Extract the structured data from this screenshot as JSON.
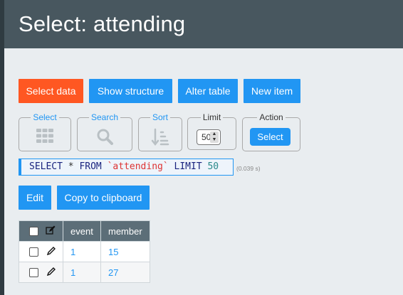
{
  "page": {
    "title": "Select: attending"
  },
  "toolbar": {
    "select_data": "Select data",
    "show_structure": "Show structure",
    "alter_table": "Alter table",
    "new_item": "New item"
  },
  "controls": {
    "select_legend": "Select",
    "search_legend": "Search",
    "sort_legend": "Sort",
    "limit_legend": "Limit",
    "limit_value": "50",
    "action_legend": "Action",
    "action_button": "Select"
  },
  "query": {
    "parts": [
      "SELECT",
      " * ",
      "FROM",
      " ",
      "`attending`",
      " ",
      "LIMIT",
      " ",
      "50"
    ],
    "time": "(0.039 s)"
  },
  "actions": {
    "edit": "Edit",
    "copy": "Copy to clipboard"
  },
  "table": {
    "columns": [
      "event",
      "member"
    ],
    "rows": [
      {
        "event": "1",
        "member": "15"
      },
      {
        "event": "1",
        "member": "27"
      }
    ]
  },
  "icons": [
    "grid-icon",
    "search-icon",
    "sort-icon",
    "edit-pencil-icon"
  ],
  "colors": {
    "header": "#48575f",
    "accent": "#2196f3",
    "active": "#ff5722"
  }
}
